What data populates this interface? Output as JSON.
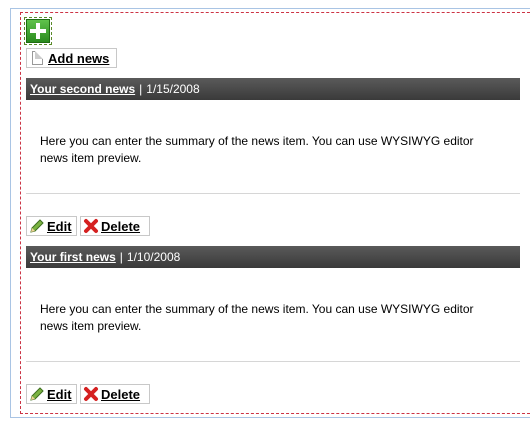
{
  "toolbar": {
    "add_news_label": "Add news"
  },
  "icons": {
    "add": "plus-icon",
    "doc": "document-icon",
    "edit": "pencil-icon",
    "delete": "x-icon"
  },
  "news": [
    {
      "title": "Your second news",
      "date": "1/15/2008",
      "summary_line1": "Here you can enter the summary of the news item. You can use WYSIWYG editor",
      "summary_line2": "news item preview.",
      "edit_label": "Edit",
      "delete_label": "Delete"
    },
    {
      "title": "Your first news",
      "date": "1/10/2008",
      "summary_line1": "Here you can enter the summary of the news item. You can use WYSIWYG editor",
      "summary_line2": "news item preview.",
      "edit_label": "Edit",
      "delete_label": "Delete"
    }
  ],
  "colors": {
    "header_bg": "#444444",
    "frame": "#a9c4e4",
    "dashed": "#cc3344",
    "add_green": "#3aa52a"
  }
}
